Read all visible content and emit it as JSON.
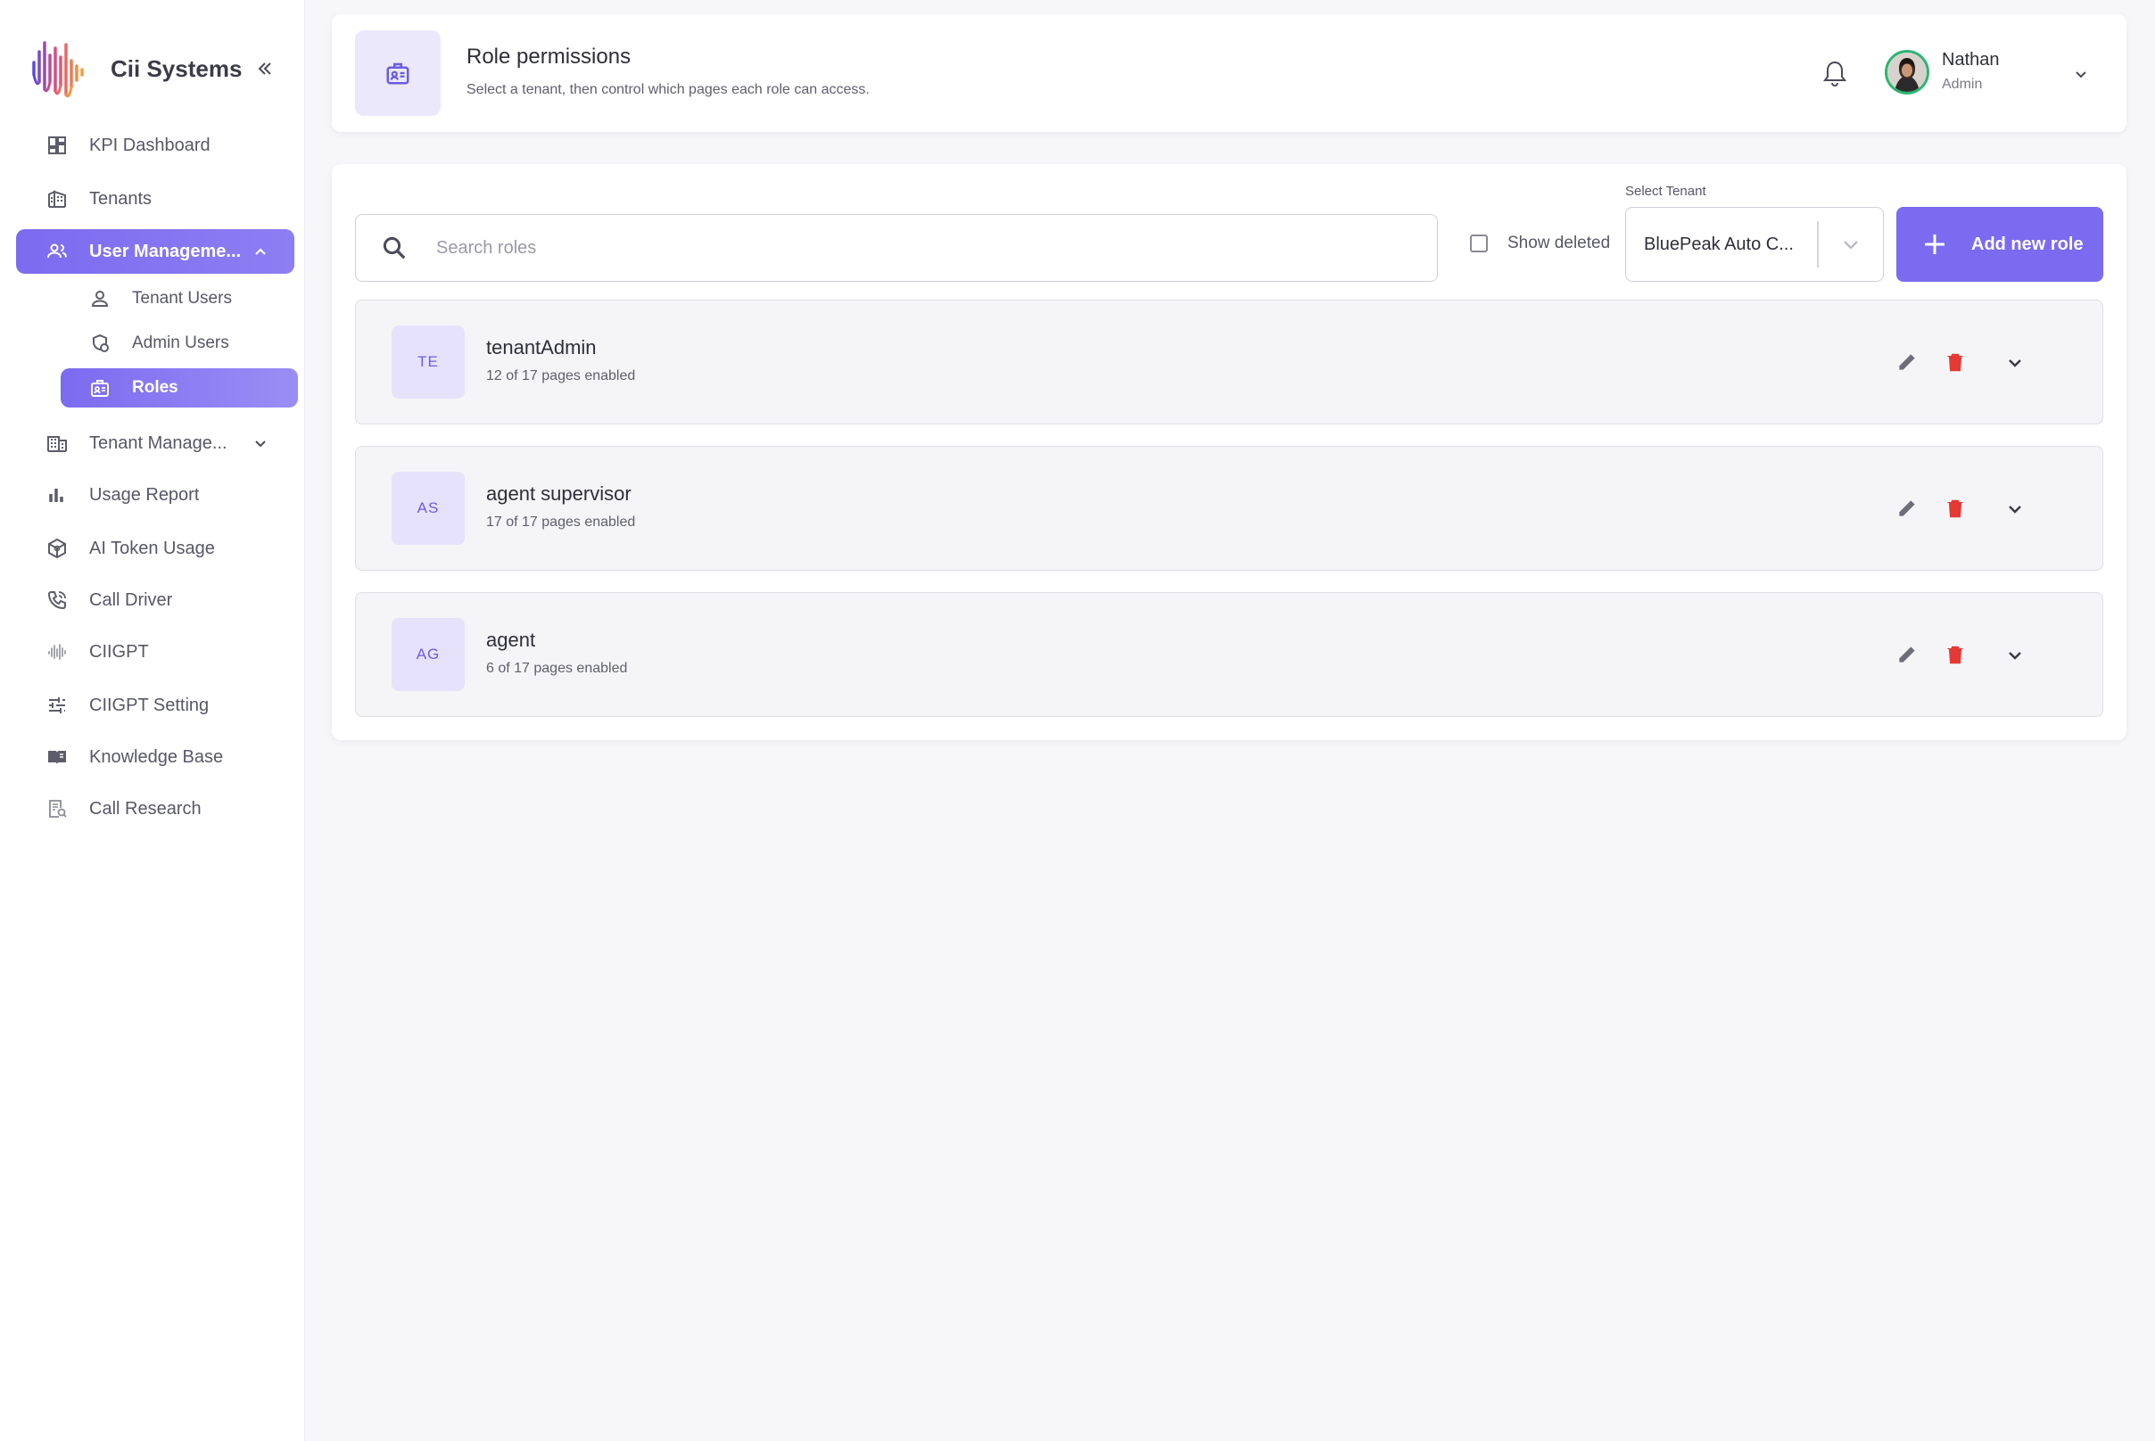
{
  "brand": {
    "name": "Cii Systems"
  },
  "sidebar": {
    "items": [
      {
        "label": "KPI Dashboard",
        "icon": "dashboard-icon"
      },
      {
        "label": "Tenants",
        "icon": "building-icon"
      },
      {
        "label": "User Manageme...",
        "icon": "users-icon",
        "active": true,
        "expanded": true
      },
      {
        "label": "Tenant Manage...",
        "icon": "office-icon",
        "expanded": false
      },
      {
        "label": "Usage Report",
        "icon": "bar-chart-icon"
      },
      {
        "label": "AI Token Usage",
        "icon": "cube-icon"
      },
      {
        "label": "Call Driver",
        "icon": "phone-call-icon"
      },
      {
        "label": "CIIGPT",
        "icon": "waveform-icon"
      },
      {
        "label": "CIIGPT Setting",
        "icon": "sliders-icon"
      },
      {
        "label": "Knowledge Base",
        "icon": "book-icon"
      },
      {
        "label": "Call Research",
        "icon": "report-search-icon"
      }
    ],
    "sub_items": [
      {
        "label": "Tenant Users",
        "icon": "person-icon"
      },
      {
        "label": "Admin Users",
        "icon": "admin-user-icon"
      },
      {
        "label": "Roles",
        "icon": "id-badge-icon",
        "active": true
      }
    ]
  },
  "header": {
    "title": "Role permissions",
    "subtitle": "Select a tenant, then control which pages each role can access.",
    "user_name": "Nathan",
    "user_role": "Admin"
  },
  "toolbar": {
    "search_placeholder": "Search roles",
    "show_deleted_label": "Show deleted",
    "show_deleted_checked": false,
    "tenant_label": "Select Tenant",
    "tenant_value": "BluePeak Auto C...",
    "add_label": "Add new role"
  },
  "roles": [
    {
      "initials": "TE",
      "name": "tenantAdmin",
      "pages": "12 of 17 pages enabled"
    },
    {
      "initials": "AS",
      "name": "agent supervisor",
      "pages": "17 of 17 pages enabled"
    },
    {
      "initials": "AG",
      "name": "agent",
      "pages": "6 of 17 pages enabled"
    }
  ],
  "colors": {
    "accent": "#7b6bf0",
    "accent_light": "#ebe8fc",
    "danger": "#e53935",
    "online": "#2bb673"
  }
}
